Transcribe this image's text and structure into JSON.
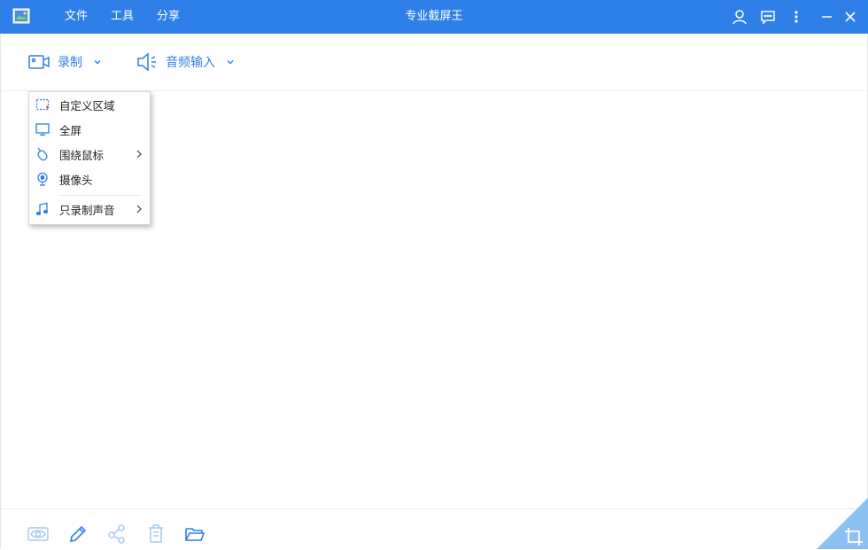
{
  "titlebar": {
    "title": "专业截屏王",
    "menu": [
      {
        "label": "文件"
      },
      {
        "label": "工具"
      },
      {
        "label": "分享"
      }
    ],
    "buttons": [
      "user-icon",
      "feedback-icon",
      "more-icon",
      "minimize-icon",
      "close-icon"
    ]
  },
  "toolbar": {
    "record_label": "录制",
    "audio_label": "音频输入"
  },
  "dropdown": {
    "items": [
      {
        "label": "自定义区域",
        "icon": "custom-region-icon",
        "submenu": false
      },
      {
        "label": "全屏",
        "icon": "monitor-icon",
        "submenu": false
      },
      {
        "label": "围绕鼠标",
        "icon": "mouse-icon",
        "submenu": true
      },
      {
        "label": "摄像头",
        "icon": "webcam-icon",
        "submenu": false
      },
      {
        "label": "只录制声音",
        "icon": "music-note-icon",
        "submenu": true
      }
    ]
  },
  "bottombar": {
    "buttons": [
      "eye-icon",
      "pencil-icon",
      "share-icon",
      "trash-icon",
      "folder-open-icon",
      "crop-icon"
    ]
  },
  "colors": {
    "accent": "#2f7fe8",
    "disabled_icon": "#a9c9f2",
    "corner": "#8dbff0"
  }
}
